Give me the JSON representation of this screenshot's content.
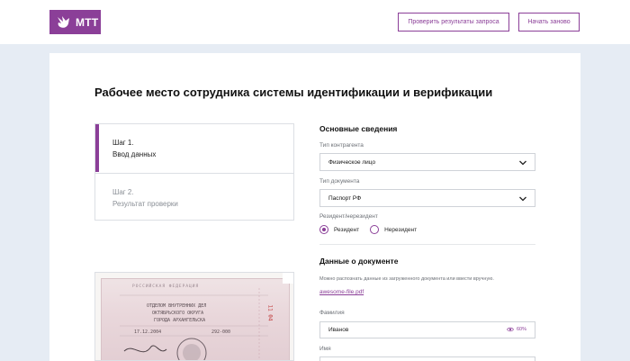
{
  "header": {
    "logo_text": "МТТ",
    "check_button": "Проверить результаты запроса",
    "restart_button": "Начать заново"
  },
  "page": {
    "title": "Рабочее место сотрудника системы идентификации и верификации"
  },
  "steps": [
    {
      "num": "Шаг 1.",
      "name": "Ввод данных",
      "active": true
    },
    {
      "num": "Шаг 2.",
      "name": "Результат проверки",
      "active": false
    }
  ],
  "basic_info": {
    "title": "Основные сведения",
    "counterparty_label": "Тип контрагента",
    "counterparty_value": "Физическое лицо",
    "document_label": "Тип документа",
    "document_value": "Паспорт РФ",
    "residency_label": "Резидент/нерезидент",
    "residency_options": [
      "Резидент",
      "Нерезидент"
    ],
    "residency_selected": "Резидент"
  },
  "document_data": {
    "title": "Данные о документе",
    "hint": "Можно распознать данные из загруженного документа или ввести вручную.",
    "file_name": "awesome-file.pdf",
    "surname_label": "Фамилия",
    "surname_value": "Иванов",
    "surname_confidence": "60%",
    "name_label": "Имя"
  },
  "passport_scan": {
    "header": "РОССИЙСКАЯ ФЕДЕРАЦИЯ",
    "issuer_line1": "ОТДЕЛОМ ВНУТРЕННИХ ДЕЛ",
    "issuer_line2": "ОКТЯБРЬСКОГО ОКРУГА",
    "issuer_line3": "ГОРОДА АРХАНГЕЛЬСКА",
    "issue_date": "17.12.2004",
    "dept_code": "292-000",
    "series_side": "11 04"
  },
  "colors": {
    "accent": "#8b3f98",
    "background": "#e6ecf4"
  },
  "icons": [
    "logo-bird-icon",
    "chevron-down-icon",
    "eye-icon"
  ]
}
